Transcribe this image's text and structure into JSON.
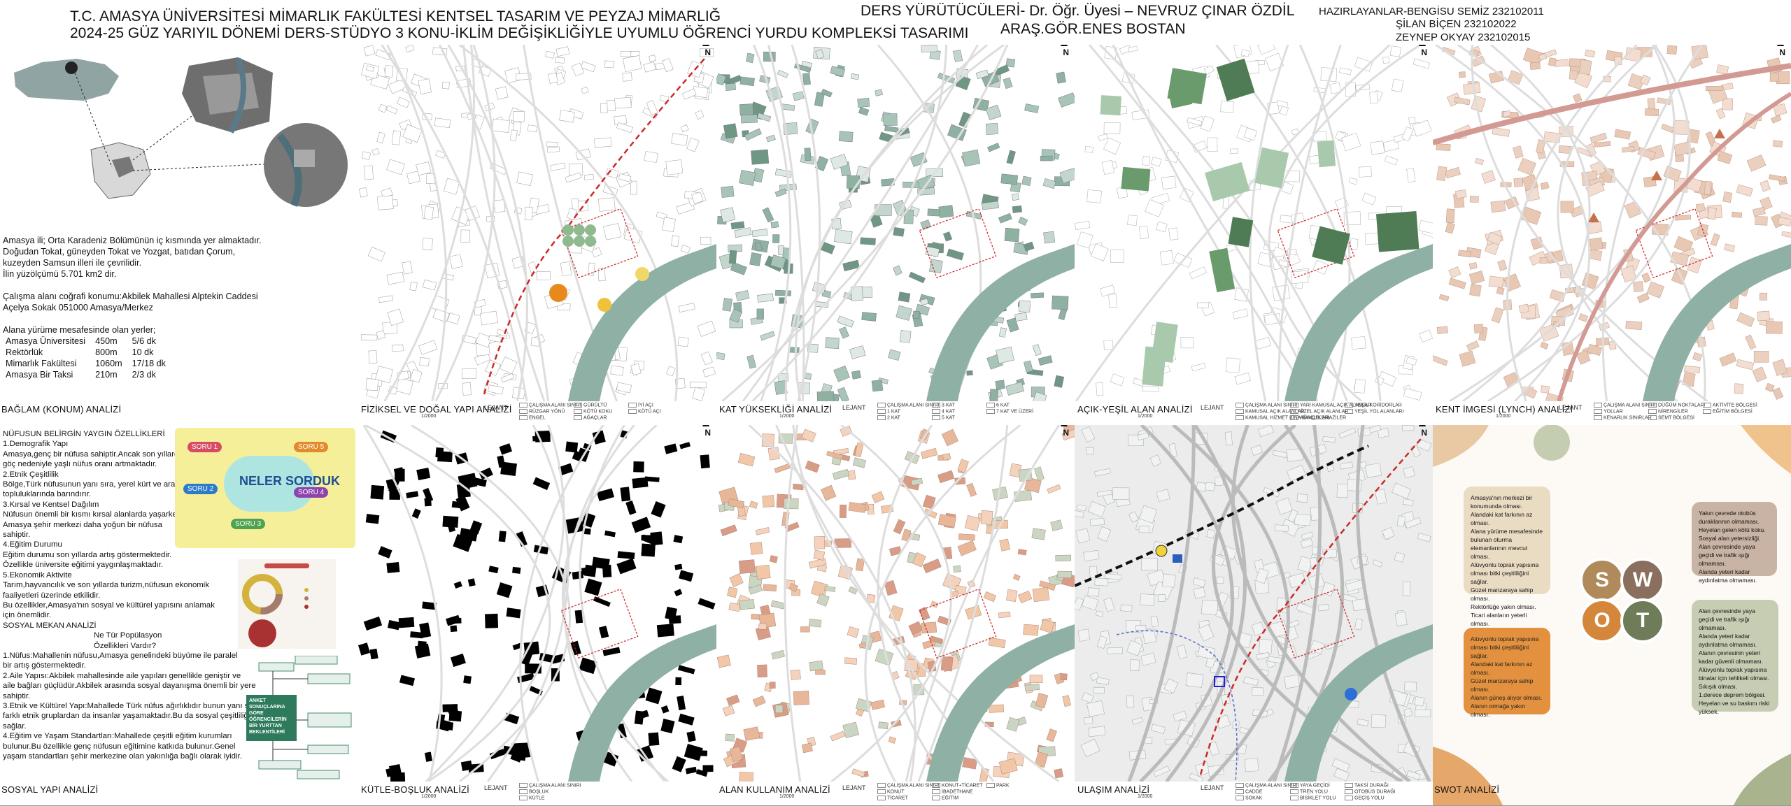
{
  "header": {
    "title_line1": "T.C. AMASYA ÜNİVERSİTESİ MİMARLIK FAKÜLTESİ KENTSEL TASARIM VE PEYZAJ MİMARLIĞ",
    "title_line2": "2024-25 GÜZ YARIYIL DÖNEMİ DERS-STÜDYO 3 KONU-İKLİM DEĞİŞİKLİĞİYLE UYUMLU ÖĞRENCİ YURDU KOMPLEKSİ TASARIMI",
    "instructor_line1": "DERS YÜRÜTÜCÜLERİ- Dr. Öğr. Üyesi – NEVRUZ ÇINAR ÖZDİL",
    "instructor_line2": "ARAŞ.GÖR.ENES BOSTAN",
    "authors": [
      "HAZIRLAYANLAR-BENGİSU SEMİZ 232102011",
      "ŞİLAN BİÇEN 232102022",
      "ZEYNEP OKYAY 232102015"
    ]
  },
  "panels": {
    "location": "BAĞLAM (KONUM) ANALİZİ",
    "physical": "FİZİKSEL VE DOĞAL YAPI ANALİZİ",
    "heights": "KAT YÜKSEKLİĞİ ANALİZİ",
    "green": "AÇIK-YEŞİL ALAN ANALİZİ",
    "lynch": "KENT İMGESİ (LYNCH) ANALİZİ",
    "social": "SOSYAL YAPI ANALİZİ",
    "mass": "KÜTLE-BOŞLUK ANALİZİ",
    "landuse": "ALAN KULLANIM ANALİZİ",
    "transport": "ULAŞIM ANALİZİ",
    "swot": "SWOT ANALİZİ"
  },
  "legend_word": "LEJANT",
  "location_text": {
    "p1": [
      "Amasya ili; Orta Karadeniz Bölümünün iç kısmında yer almaktadır.",
      "Doğudan Tokat, güneyden Tokat ve Yozgat, batıdan Çorum,",
      "kuzeyden Samsun illeri ile çevrilidir.",
      "İlin yüzölçümü 5.701 km2 dir."
    ],
    "p2": [
      "Çalışma alanı coğrafi konumu:Akbilek Mahallesi Alptekin Caddesi",
      "Açelya Sokak 051000 Amasya/Merkez"
    ],
    "p3_title": "Alana yürüme mesafesinde olan yerler;",
    "places": [
      {
        "name": "Amasya Üniversitesi",
        "dist": "450m",
        "time": "5/6 dk"
      },
      {
        "name": "Rektörlük",
        "dist": "800m",
        "time": "10 dk"
      },
      {
        "name": "Mimarlık Fakültesi",
        "dist": "1060m",
        "time": "17/18 dk"
      },
      {
        "name": "Amasya Bir Taksi",
        "dist": "210m",
        "time": "2/3 dk"
      }
    ]
  },
  "social_text": {
    "heading": "NÜFUSUN BELİRGİN YAYGIN ÖZELLİKLERİ",
    "lines": [
      "1.Demografik Yapı",
      "Amasya,genç bir nüfusa sahiptir.Ancak son yıllarda",
      "göç nedeniyle yaşlı nüfus oranı artmaktadır.",
      "2.Etnik Çeşitlilik",
      "Bölge,Türk nüfusunun yanı sıra, yerel kürt ve arap",
      "topluluklarında barındırır.",
      "3.Kırsal ve Kentsel Dağılım",
      "Nüfusun önemli bir kısmı kırsal alanlarda yaşarken",
      "Amasya şehir merkezi daha yoğun bir nüfusa",
      "sahiptir.",
      "4.Eğitim Durumu",
      "Eğitim durumu son yıllarda artış göstermektedir.",
      "Özellikle üniversite eğitimi yaygınlaşmaktadır.",
      "5.Ekonomik Aktivite",
      "Tarım,hayvancılık ve son yıllarda turizm,nüfusun ekonomik",
      "faaliyetleri üzerinde etkilidir.",
      "Bu özellikler,Amasya'nın sosyal ve kültürel yapısını anlamak",
      "için önemlidir."
    ],
    "heading2": "SOSYAL MEKAN ANALİZİ",
    "question": "Ne Tür Popülasyon Özellikleri Vardır?",
    "lines2": [
      "1.Nüfus:Mahallenin nüfusu,Amasya genelindeki büyüme ile paralel",
      "bir artış göstermektedir.",
      "2.Aile Yapısı:Akbilek mahallesinde aile yapıları genellikle geniştir ve",
      "aile bağları güçlüdür.Akbilek arasında sosyal dayanışma önemli bir yere",
      "sahiptir.",
      "3.Etnik ve Kültürel Yapı:Mahallede Türk nüfus ağırlıklıdır bunun yanı sıra",
      "farklı etnik gruplardan da insanlar yaşamaktadır.Bu da sosyal çeşitliliği",
      "sağlar.",
      "4.Eğitim ve Yaşam Standartları:Mahallede çeşitli eğitim kurumları",
      "bulunur.Bu özellikle genç nüfusun eğitimine katkıda bulunur.Genel",
      "yaşam  standartları şehir merkezine olan yakınlığa bağlı olarak iyidir."
    ],
    "poster_title": "NELER SORDUK",
    "poster_q": [
      "SORU 1",
      "SORU 2",
      "SORU 3",
      "SORU 4",
      "SORU 5"
    ],
    "survey_box": "ANKET SONUÇLARINA GÖRE ÖĞRENCİLERİN BİR YURTTAN BEKLENTİLERİ"
  },
  "swot": {
    "letters": [
      "S",
      "W",
      "O",
      "T"
    ],
    "colors": {
      "S": "#b08a5a",
      "W": "#8a6f5e",
      "O": "#d4873a",
      "T": "#6e7c5a",
      "S_box": "#e9dcc3",
      "W_box": "#c8b3a4",
      "O_box": "#e3913e",
      "T_box": "#c6cdb3"
    },
    "S": [
      "Amasya'nın merkezi bir konumunda olması.",
      "Alandaki kat farkının az olması.",
      "Alana yürüme mesafesinde bulunan oturma elemanlarının mevcut olması.",
      "Alüvyonlu toprak yapısına olması bitki çeşitliliğini sağlar.",
      "Güzel manzaraya sahip olması.",
      "Rektörlüğe yakın olması.",
      "Ticari alanların yeterli olması."
    ],
    "W": [
      "Yakın çevrede otobüs duraklarının olmaması.",
      "Heyelan gelen kötü koku.",
      "Sosyal alan yetersizliği.",
      "Alan çevresinde yaya geçidi ve trafik ışığı olmaması.",
      "Alanda yeteri kadar aydınlatma olmaması."
    ],
    "O": [
      "Alüvyonlu toprak yapısına olması bitki çeşitliliğini sağlar.",
      "Alandaki kat farkının az olması.",
      "Güzel manzaraya sahip olması.",
      "Alanın güneş alıyor olması.",
      "Alanın ormağa yakın olması."
    ],
    "T": [
      "Alan çevresinde yaya geçidi ve trafik ışığı olmaması.",
      "Alanda yeteri kadar aydınlatma olmaması.",
      "Alanın çevresinin yeteri kadar güvenli olmaması.",
      "Alüvyonlu toprak yapısına binalar için tehlikeli olması.",
      "Sıkışık olması.",
      "1.derece deprem bölgesi.",
      "Heyelan ve su baskını riski yüksek."
    ]
  },
  "legends": {
    "physical": [
      "ÇALIŞMA ALANI SINIRI",
      "RÜZGAR YÖNÜ",
      "ENGEL",
      "GÜRÜLTÜ",
      "KÖTÜ KOKU",
      "AĞAÇLAR",
      "İYİ AÇI",
      "KÖTÜ AÇI"
    ],
    "heights": [
      "ÇALIŞMA ALANI SINIRI",
      "1 KAT",
      "2 KAT",
      "3 KAT",
      "4 KAT",
      "5 KAT",
      "6 KAT",
      "7 KAT VE ÜZERİ"
    ],
    "green": [
      "ÇALIŞMA ALANI SINIRI",
      "KAMUSAL AÇIK ALANLAR",
      "KAMUSAL HİZMET BİNA BAHÇELERİ",
      "YARI KAMUSAL AÇIK ALANLAR",
      "ÖZEL AÇIK ALANLAR",
      "AĞAÇLIK ARAZİLER",
      "YEŞİL KORİDORLAR",
      "YEŞİL YOL ALANLARI"
    ],
    "lynch": [
      "ÇALIŞMA ALANI SINIRI",
      "YOLLAR",
      "KENARLIK SINIRLAR",
      "DÜĞÜM NOKTALARI",
      "NİRENGİLER",
      "SEMT BÖLGESİ",
      "AKTİVİTE BÖLGESİ",
      "EĞİTİM BÖLGESİ"
    ],
    "mass": [
      "ÇALIŞMA ALANI SINIRI",
      "BOŞLUK",
      "KÜTLE"
    ],
    "landuse": [
      "ÇALIŞMA ALANI SINIRI",
      "KONUT",
      "TİCARET",
      "KONUT+TİCARET",
      "İBADETHANE",
      "EĞİTİM",
      "PARK"
    ],
    "transport": [
      "ÇALIŞMA ALANI SINIRI",
      "CADDE",
      "SOKAK",
      "YAYA GEÇİDİ",
      "TREN YOLU",
      "BİSİKLET YOLU",
      "TAKSİ DURAĞI",
      "OTOBÜS DURAĞI",
      "GEÇİŞ YOLU"
    ]
  },
  "scale": "1/2000",
  "north": "N"
}
